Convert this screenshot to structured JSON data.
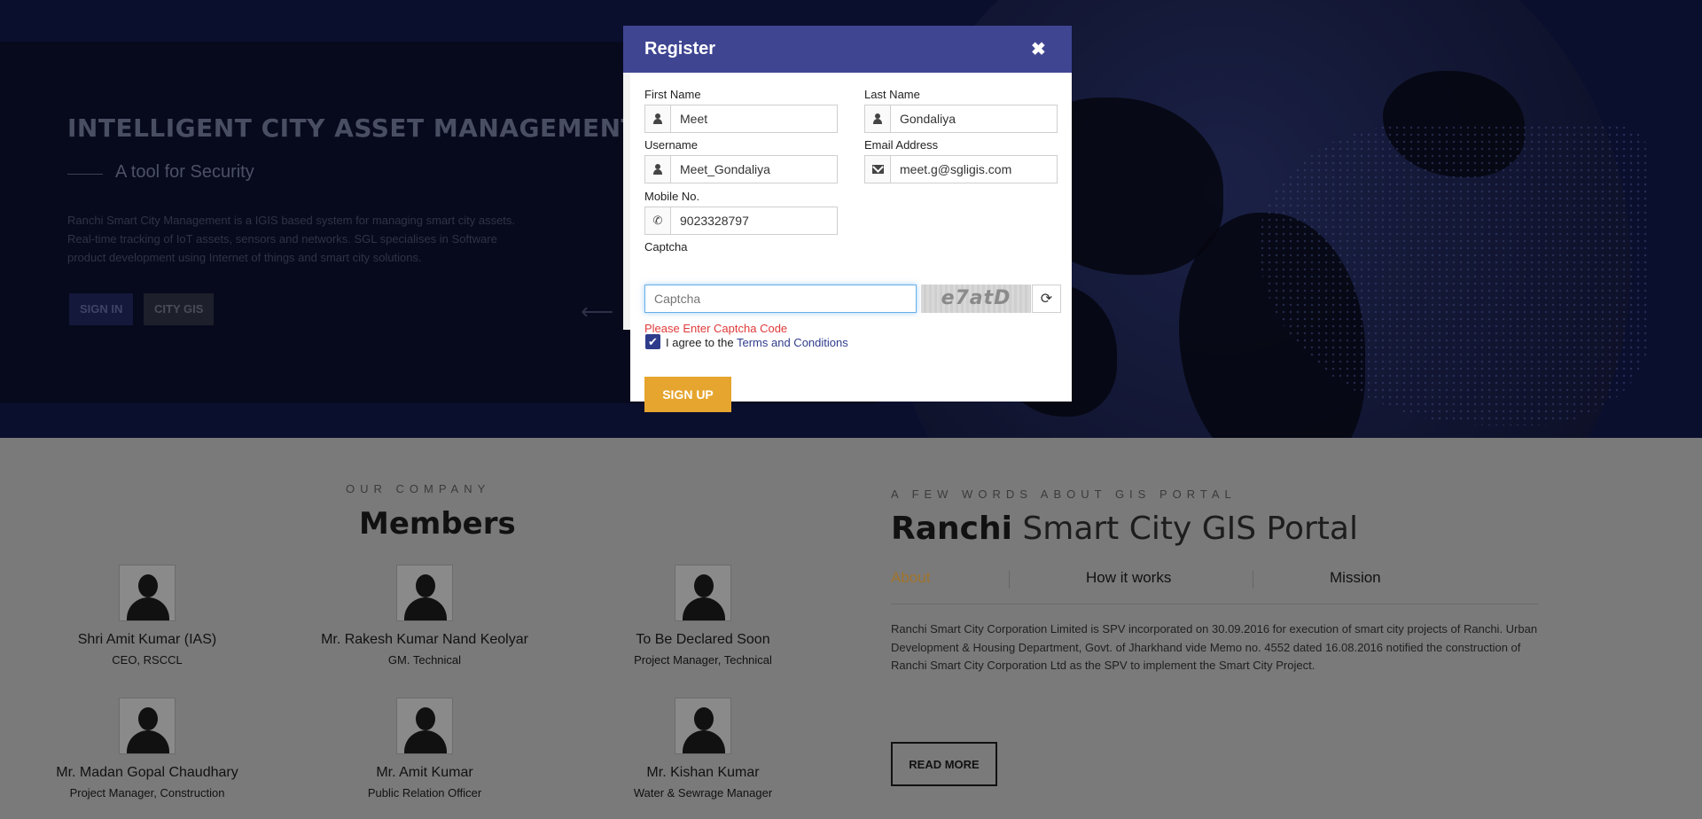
{
  "hero": {
    "title": "INTELLIGENT CITY ASSET MANAGEMENT",
    "subtitle": "A tool for Security",
    "description": "Ranchi Smart City Management is a IGIS based system for managing smart city assets. Real-time tracking of IoT assets, sensors and networks. SGL specialises in Software product development using Internet of things and smart city solutions.",
    "sign_in_label": "SIGN IN",
    "city_gis_label": "CITY GIS",
    "arrow": "⟵"
  },
  "company": {
    "kicker": "OUR COMPANY",
    "title": "Members",
    "members": [
      {
        "name": "Shri Amit Kumar (IAS)",
        "role": "CEO, RSCCL"
      },
      {
        "name": "Mr. Rakesh Kumar Nand Keolyar",
        "role": "GM. Technical"
      },
      {
        "name": "To Be Declared Soon",
        "role": "Project Manager, Technical"
      },
      {
        "name": "Mr. Madan Gopal Chaudhary",
        "role": "Project Manager, Construction"
      },
      {
        "name": "Mr. Amit Kumar",
        "role": "Public Relation Officer"
      },
      {
        "name": "Mr. Kishan Kumar",
        "role": "Water & Sewrage Manager"
      }
    ]
  },
  "portal": {
    "kicker": "A FEW WORDS ABOUT GIS PORTAL",
    "title_bold": "Ranchi",
    "title_rest": " Smart City GIS Portal",
    "tabs": [
      "About",
      "How it works",
      "Mission"
    ],
    "active_tab": "About",
    "about_text": "Ranchi Smart City Corporation Limited is SPV incorporated on 30.09.2016 for execution of smart city projects of Ranchi. Urban Development & Housing Department, Govt. of Jharkhand vide Memo no. 4552 dated 16.08.2016 notified the construction of Ranchi Smart City Corporation Ltd as the SPV to implement the Smart City Project.",
    "read_more_label": "READ MORE"
  },
  "modal": {
    "title": "Register",
    "close_glyph": "✖",
    "fields": {
      "first_name": {
        "label": "First Name",
        "value": "Meet"
      },
      "last_name": {
        "label": "Last Name",
        "value": "Gondaliya"
      },
      "username": {
        "label": "Username",
        "value": "Meet_Gondaliya"
      },
      "email": {
        "label": "Email Address",
        "value": "meet.g@sgligis.com"
      },
      "mobile": {
        "label": "Mobile No.",
        "value": "9023328797"
      },
      "captcha": {
        "label": "Captcha",
        "placeholder": "Captcha",
        "value": ""
      }
    },
    "captcha_code": "e7atD",
    "captcha_error": "Please Enter Captcha Code",
    "agree_prefix": "I agree to the ",
    "agree_link": "Terms and Conditions",
    "agree_checked": true,
    "signup_label": "SIGN UP",
    "refresh_glyph": "⟳",
    "phone_glyph": "✆",
    "check_glyph": "✔"
  },
  "colors": {
    "modal_header": "#3f4591",
    "signup_button": "#e6a52e",
    "error_text": "#e03a3a",
    "active_tab": "#a1732a"
  }
}
